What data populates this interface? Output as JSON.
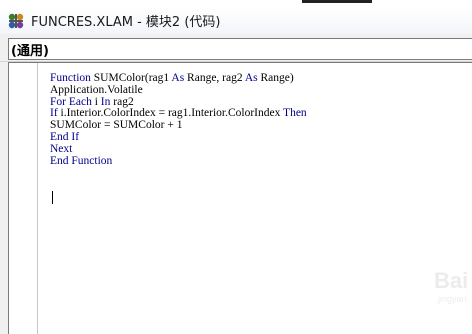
{
  "window": {
    "title": "FUNCRES.XLAM - 模块2 (代码)"
  },
  "object_combo": {
    "value": "(通用)"
  },
  "code_lines": [
    [
      {
        "t": "Function",
        "k": true
      },
      {
        "t": " SUMColor(rag1 ",
        "k": false
      },
      {
        "t": "As",
        "k": true
      },
      {
        "t": " Range, rag2 ",
        "k": false
      },
      {
        "t": "As",
        "k": true
      },
      {
        "t": " Range)",
        "k": false
      }
    ],
    [
      {
        "t": "Application.Volatile",
        "k": false
      }
    ],
    [
      {
        "t": "For Each",
        "k": true
      },
      {
        "t": " i ",
        "k": false
      },
      {
        "t": "In",
        "k": true
      },
      {
        "t": " rag2",
        "k": false
      }
    ],
    [
      {
        "t": "If",
        "k": true
      },
      {
        "t": " i.Interior.ColorIndex = rag1.Interior.ColorIndex ",
        "k": false
      },
      {
        "t": "Then",
        "k": true
      }
    ],
    [
      {
        "t": "SUMColor = SUMColor + 1",
        "k": false
      }
    ],
    [
      {
        "t": "End If",
        "k": true
      }
    ],
    [
      {
        "t": "Next",
        "k": true
      }
    ],
    [
      {
        "t": "End Function",
        "k": true
      }
    ]
  ],
  "watermark": {
    "main": "Bai",
    "sub": "jingyan"
  },
  "colors": {
    "keyword": "#00008b",
    "text": "#000000",
    "editor_bg": "#ffffff",
    "chrome_bg": "#f0f0f0"
  },
  "icons": {
    "title_icon": "vba-module-icon"
  }
}
